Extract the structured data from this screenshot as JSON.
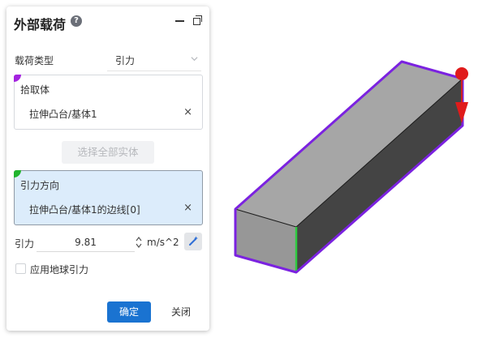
{
  "dialog": {
    "title": "外部载荷",
    "help_icon": "question-circle-icon",
    "minimize_icon": "minimize-icon",
    "restore_icon": "restore-window-icon"
  },
  "load_type": {
    "label": "载荷类型",
    "value": "引力"
  },
  "pick_body": {
    "title": "拾取体",
    "items": [
      "拉伸凸台/基体1"
    ],
    "remove_symbol": "×"
  },
  "select_all_label": "选择全部实体",
  "gravity_direction": {
    "title": "引力方向",
    "items": [
      "拉伸凸台/基体1的边线[0]"
    ],
    "remove_symbol": "×"
  },
  "gravity": {
    "label": "引力",
    "value": "9.81",
    "unit": "m/s^2"
  },
  "earth_gravity_checkbox": {
    "label": "应用地球引力",
    "checked": false
  },
  "buttons": {
    "ok": "确定",
    "close": "关闭"
  },
  "colors": {
    "accent": "#1a73d1",
    "pick_marker": "#a423e0",
    "direction_marker": "#21b42d",
    "selection_outline": "#7b22e0",
    "gravity_arrow": "#e01b1b"
  }
}
